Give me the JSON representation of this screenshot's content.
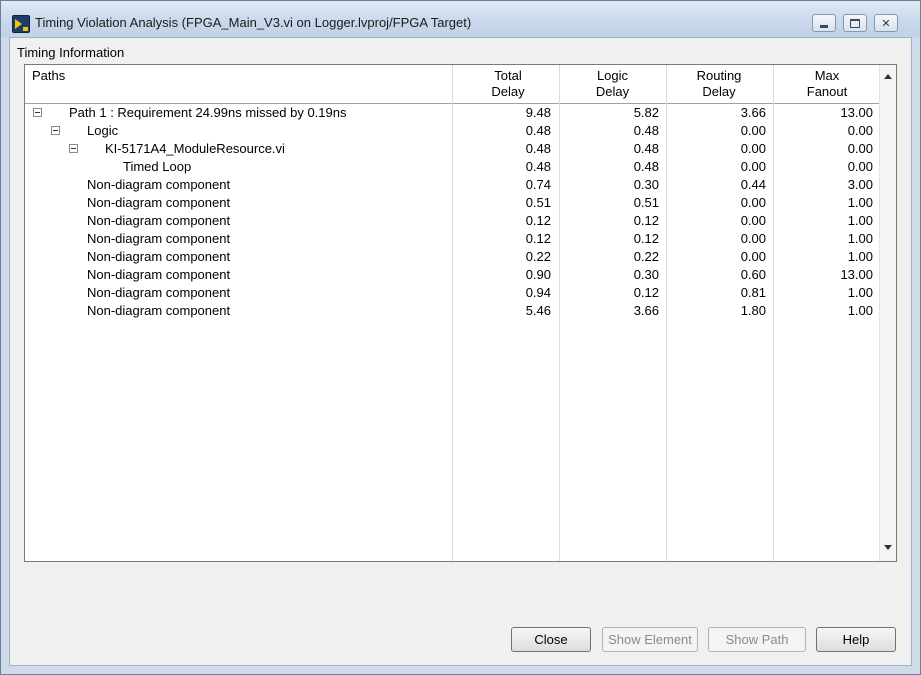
{
  "window": {
    "title": "Timing Violation Analysis (FPGA_Main_V3.vi on Logger.lvproj/FPGA Target)",
    "controls": {
      "minimize": "minimize",
      "maximize": "maximize",
      "close": "✕"
    }
  },
  "section_label": "Timing Information",
  "table": {
    "headers": {
      "paths": "Paths",
      "total": [
        "Total",
        "Delay"
      ],
      "logic": [
        "Logic",
        "Delay"
      ],
      "routing": [
        "Routing",
        "Delay"
      ],
      "fanout": [
        "Max",
        "Fanout"
      ]
    },
    "rows": [
      {
        "label": "Path 1 : Requirement 24.99ns missed by 0.19ns",
        "total": "9.48",
        "logic": "5.82",
        "routing": "3.66",
        "fanout": "13.00"
      },
      {
        "label": "Logic",
        "total": "0.48",
        "logic": "0.48",
        "routing": "0.00",
        "fanout": "0.00"
      },
      {
        "label": "KI-5171A4_ModuleResource.vi",
        "total": "0.48",
        "logic": "0.48",
        "routing": "0.00",
        "fanout": "0.00"
      },
      {
        "label": "Timed Loop",
        "total": "0.48",
        "logic": "0.48",
        "routing": "0.00",
        "fanout": "0.00"
      },
      {
        "label": "Non-diagram component",
        "total": "0.74",
        "logic": "0.30",
        "routing": "0.44",
        "fanout": "3.00"
      },
      {
        "label": "Non-diagram component",
        "total": "0.51",
        "logic": "0.51",
        "routing": "0.00",
        "fanout": "1.00"
      },
      {
        "label": "Non-diagram component",
        "total": "0.12",
        "logic": "0.12",
        "routing": "0.00",
        "fanout": "1.00"
      },
      {
        "label": "Non-diagram component",
        "total": "0.12",
        "logic": "0.12",
        "routing": "0.00",
        "fanout": "1.00"
      },
      {
        "label": "Non-diagram component",
        "total": "0.22",
        "logic": "0.22",
        "routing": "0.00",
        "fanout": "1.00"
      },
      {
        "label": "Non-diagram component",
        "total": "0.90",
        "logic": "0.30",
        "routing": "0.60",
        "fanout": "13.00"
      },
      {
        "label": "Non-diagram component",
        "total": "0.94",
        "logic": "0.12",
        "routing": "0.81",
        "fanout": "1.00"
      },
      {
        "label": "Non-diagram component",
        "total": "5.46",
        "logic": "3.66",
        "routing": "1.80",
        "fanout": "1.00"
      }
    ]
  },
  "buttons": {
    "close": "Close",
    "show_element": "Show Element",
    "show_path": "Show Path",
    "help": "Help"
  }
}
